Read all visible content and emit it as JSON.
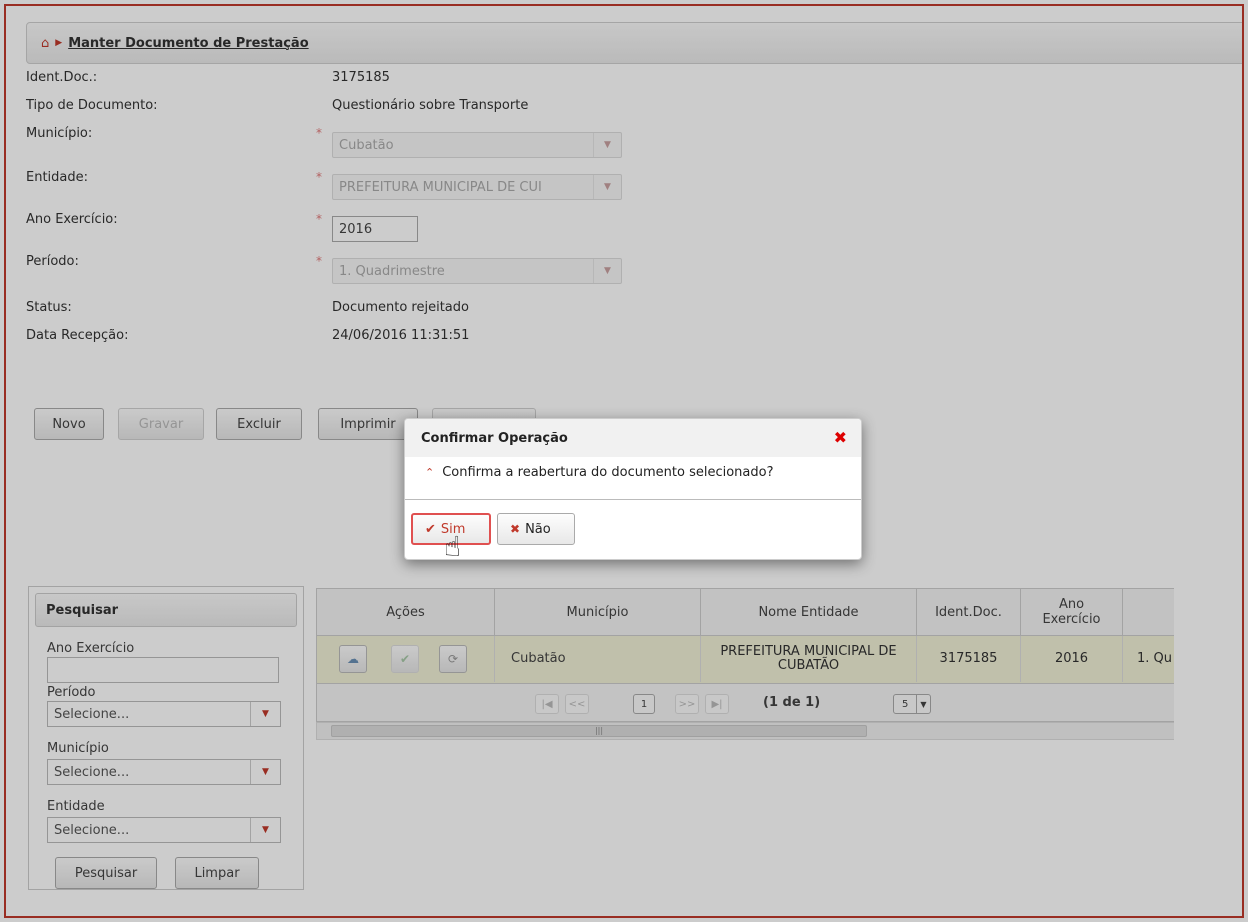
{
  "breadcrumb": {
    "title": "Manter Documento de Prestação"
  },
  "form": {
    "ident_label": "Ident.Doc.:",
    "ident_value": "3175185",
    "tipo_label": "Tipo de Documento:",
    "tipo_value": "Questionário sobre Transporte",
    "municipio_label": "Município:",
    "municipio_value": "Cubatão",
    "entidade_label": "Entidade:",
    "entidade_value": "PREFEITURA MUNICIPAL DE CUI",
    "ano_label": "Ano Exercício:",
    "ano_value": "2016",
    "periodo_label": "Período:",
    "periodo_value": "1. Quadrimestre",
    "status_label": "Status:",
    "status_value": "Documento rejeitado",
    "data_label": "Data Recepção:",
    "data_value": "24/06/2016 11:31:51",
    "required_mark": "*"
  },
  "toolbar": {
    "novo": "Novo",
    "gravar": "Gravar",
    "excluir": "Excluir",
    "imprimir": "Imprimir"
  },
  "dialog": {
    "title": "Confirmar Operação",
    "message": "Confirma a reabertura do documento selecionado?",
    "yes": "Sim",
    "no": "Não"
  },
  "search": {
    "title": "Pesquisar",
    "ano_label": "Ano Exercício",
    "periodo_label": "Período",
    "periodo_value": "Selecione...",
    "municipio_label": "Município",
    "municipio_value": "Selecione...",
    "entidade_label": "Entidade",
    "entidade_value": "Selecione...",
    "search_button": "Pesquisar",
    "clear_button": "Limpar"
  },
  "table": {
    "headers": [
      "Ações",
      "Município",
      "Nome Entidade",
      "Ident.Doc.",
      "Ano Exercício"
    ],
    "row": {
      "municipio": "Cubatão",
      "entidade": "PREFEITURA MUNICIPAL DE CUBATÃO",
      "ident": "3175185",
      "ano": "2016",
      "periodo": "1. Qu"
    },
    "pager": {
      "current_page": "1",
      "page_info": "(1 de 1)",
      "page_size": "5"
    }
  },
  "icons": {
    "home": "home-icon",
    "close": "close-icon",
    "check": "check-icon",
    "cursor": "hand-cursor-icon"
  }
}
